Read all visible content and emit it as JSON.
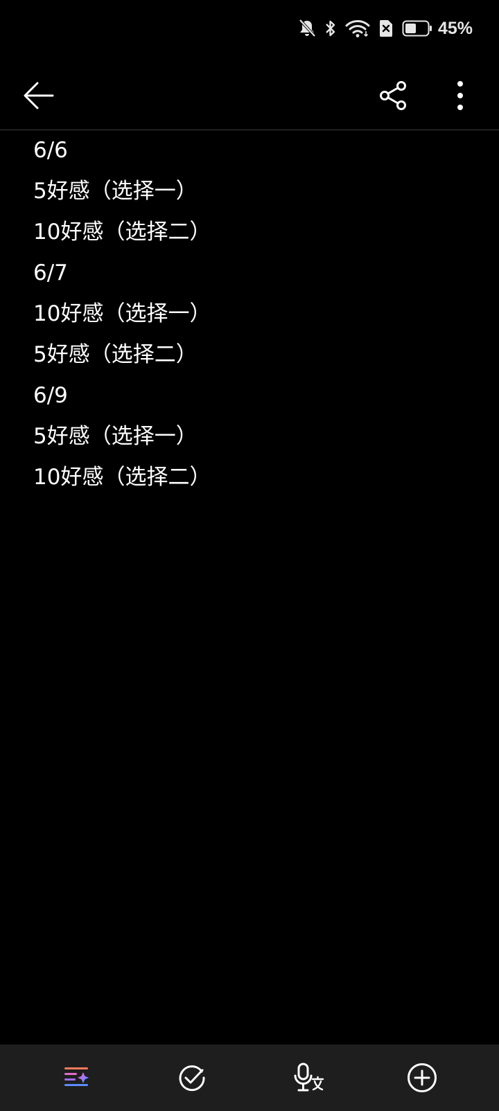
{
  "status_bar": {
    "battery_percent": "45%",
    "icons": [
      "bell-off-icon",
      "bluetooth-icon",
      "wifi-icon",
      "no-sim-icon",
      "battery-icon"
    ]
  },
  "app_bar": {
    "icons": [
      "back-arrow-icon",
      "share-icon",
      "more-vertical-icon"
    ]
  },
  "note": {
    "lines": [
      "6/6",
      "5好感（选择一）",
      "10好感（选择二）",
      "6/7",
      "10好感（选择一）",
      "5好感（选择二）",
      "6/9",
      "5好感（选择一）",
      "10好感（选择二）"
    ]
  },
  "bottom_toolbar": {
    "icons": [
      "ai-format-icon",
      "checklist-icon",
      "voice-to-text-icon",
      "add-icon"
    ]
  },
  "colors": {
    "background": "#000000",
    "text": "#ffffff",
    "toolbar_background": "#1e1e1e",
    "divider": "#3a3a3a"
  }
}
